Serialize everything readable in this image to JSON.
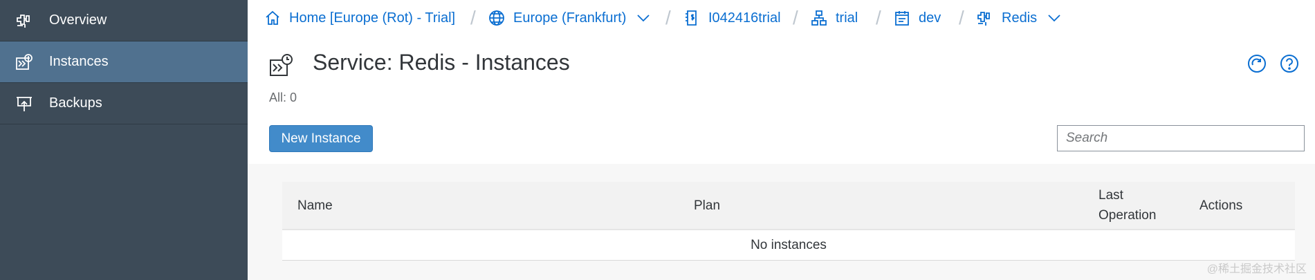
{
  "sidebar": {
    "items": [
      {
        "label": "Overview",
        "icon": "service-plug-icon",
        "active": false
      },
      {
        "label": "Instances",
        "icon": "instances-icon",
        "active": true
      },
      {
        "label": "Backups",
        "icon": "backup-icon",
        "active": false
      }
    ]
  },
  "breadcrumb": {
    "items": [
      {
        "label": "Home [Europe (Rot) - Trial]",
        "icon": "home-icon"
      },
      {
        "label": "Europe (Frankfurt)",
        "icon": "globe-icon",
        "dropdown": true
      },
      {
        "label": "I042416trial",
        "icon": "account-icon"
      },
      {
        "label": "trial",
        "icon": "org-icon"
      },
      {
        "label": "dev",
        "icon": "space-icon"
      },
      {
        "label": "Redis",
        "icon": "service-plug-icon",
        "dropdown": true
      }
    ],
    "separator": "/"
  },
  "page": {
    "title": "Service: Redis - Instances",
    "count_label": "All: 0"
  },
  "toolbar": {
    "new_instance_label": "New Instance",
    "search_placeholder": "Search"
  },
  "table": {
    "columns": [
      "Name",
      "Plan",
      "Last Operation",
      "Actions"
    ],
    "empty_text": "No instances"
  },
  "watermark": "@稀土掘金技术社区",
  "colors": {
    "sidebar_bg": "#3d4b58",
    "sidebar_active": "#50718f",
    "link": "#0a6ed1",
    "button": "#428bca"
  }
}
